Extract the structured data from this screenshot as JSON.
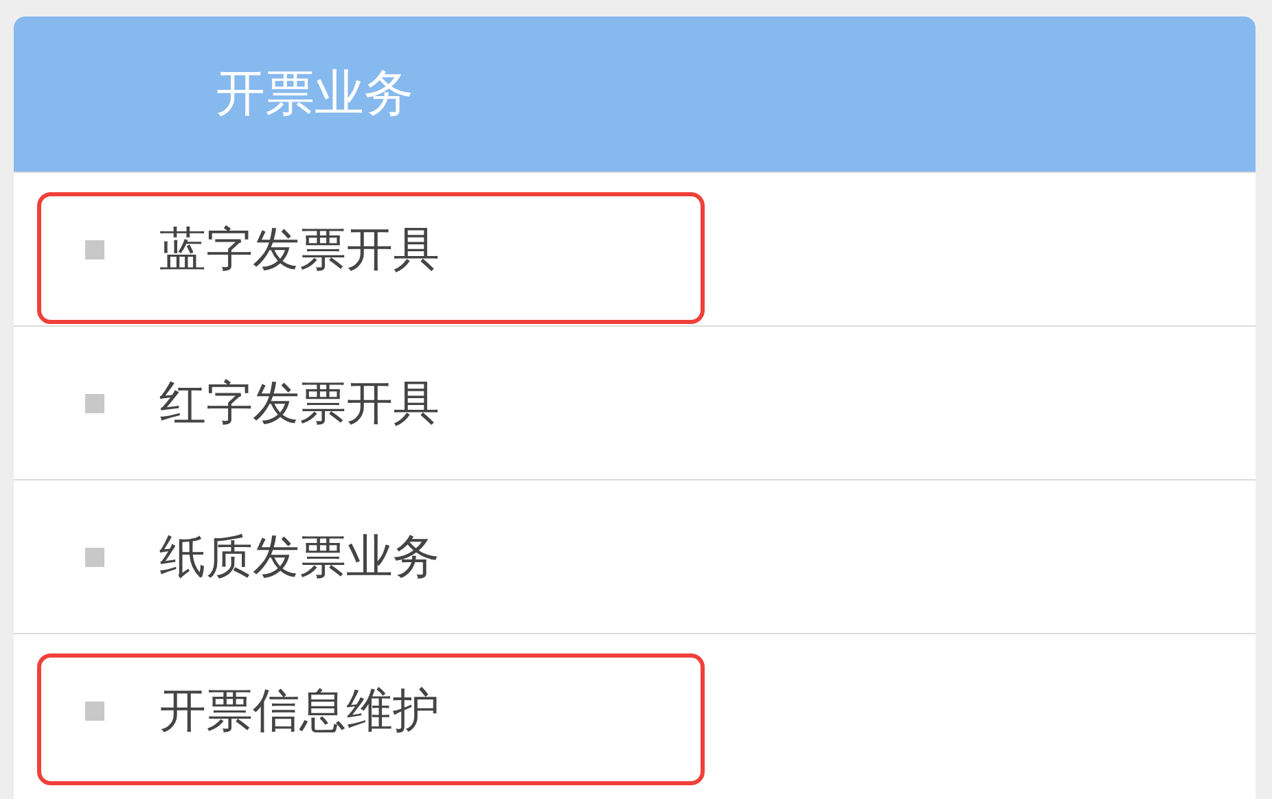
{
  "menu": {
    "title": "开票业务",
    "items": [
      {
        "label": "蓝字发票开具",
        "highlighted": true
      },
      {
        "label": "红字发票开具",
        "highlighted": false
      },
      {
        "label": "纸质发票业务",
        "highlighted": false
      },
      {
        "label": "开票信息维护",
        "highlighted": true
      }
    ]
  }
}
